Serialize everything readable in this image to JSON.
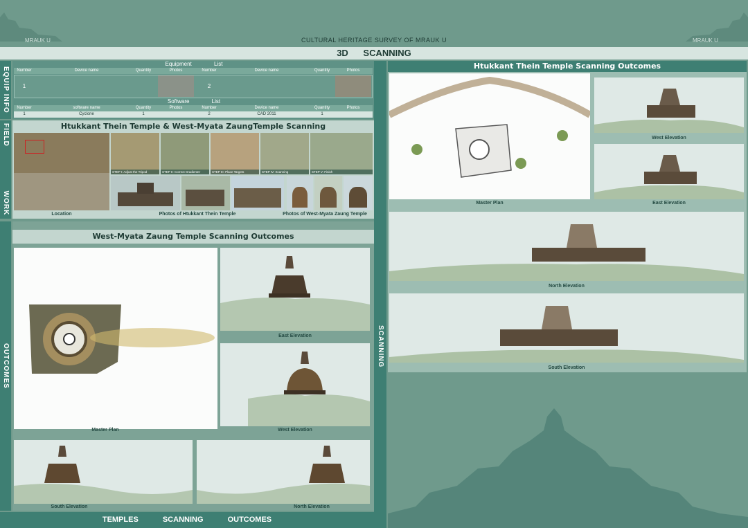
{
  "header": {
    "brand_left": "MRAUK U",
    "brand_right": "MRAUK U",
    "survey_title": "CULTURAL HERITAGE SURVEY OF MRAUK U",
    "section_title": "3D SCANNING"
  },
  "sections": {
    "equip_info": "EQUIP INFO",
    "field_work": "FIELD WORK",
    "outcomes": "OUTCOMES",
    "scanning": "SCANNING"
  },
  "equipment": {
    "title": "Equipment List",
    "headers": [
      "Number",
      "Device name",
      "Quantity",
      "Photos",
      "Number",
      "Device name",
      "Quantity",
      "Photos"
    ],
    "row_numbers": [
      "1",
      "2"
    ]
  },
  "software": {
    "title": "Software List",
    "headers": [
      "Number",
      "software name",
      "Quantity",
      "Photos",
      "Number",
      "Device name",
      "Quantity",
      "Photos"
    ],
    "row": [
      "1",
      "Cyclone",
      "1",
      "",
      "2",
      "CAD 2011",
      "1",
      ""
    ]
  },
  "field": {
    "title": "Htukkant Thein Temple & West-Myata ZaungTemple Scanning",
    "steps": [
      "STEP I: Adjust the Tripod",
      "STEP II: Correct Gradienter",
      "STEP III: Place Targets",
      "STEP IV: Scanning",
      "STEP V: Finish"
    ],
    "captions": [
      "Location",
      "Photos of Htukkant Thein Temple",
      "Photos of West-Myata Zaung Temple"
    ]
  },
  "west_outcomes": {
    "title": "West-Myata Zaung Temple Scanning Outcomes",
    "captions": [
      "Master Plan",
      "East Elevation",
      "West Elevation",
      "South Elevation",
      "North Elevation"
    ]
  },
  "htukkant_outcomes": {
    "title": "Htukkant Thein Temple Scanning Outcomes",
    "captions": [
      "Master Plan",
      "West Elevation",
      "East Elevation",
      "North Elevation",
      "South Elevation"
    ]
  },
  "footer": {
    "label": "TEMPLES SCANNING OUTCOMES"
  },
  "colors": {
    "background": "#6f9a8c",
    "accent": "#3e7f73",
    "band": "#c3d6cf"
  }
}
